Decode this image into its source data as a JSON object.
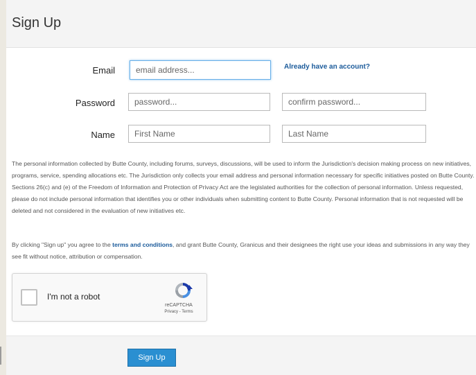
{
  "header": {
    "title": "Sign Up"
  },
  "form": {
    "email_label": "Email",
    "email_placeholder": "email address...",
    "account_link": "Already have an account?",
    "password_label": "Password",
    "password_placeholder": "password...",
    "confirm_placeholder": "confirm password...",
    "name_label": "Name",
    "first_placeholder": "First Name",
    "last_placeholder": "Last Name"
  },
  "privacy_text": "The personal information collected by Butte County, including forums, surveys, discussions, will be used to inform the Jurisdiction's decision making process on new initiatives, programs, service, spending allocations etc. The Jurisdiction only collects your email address and personal information necessary for specific initiatives posted on Butte County. Sections 26(c) and (e) of the Freedom of Information and Protection of Privacy Act are the legislated authorities for the collection of personal information. Unless requested, please do not include personal information that identifies you or other individuals when submitting content to Butte County. Personal information that is not requested will be deleted and not considered in the evaluation of new initiatives etc.",
  "terms": {
    "before": "By clicking \"Sign up\" you agree to the ",
    "link": "terms and conditions",
    "after": ", and grant Butte County, Granicus and their designees the right use your ideas and submissions in any way they see fit without notice, attribution or compensation."
  },
  "captcha": {
    "label": "I'm not a robot",
    "brand": "reCAPTCHA",
    "privacy_terms": "Privacy - Terms",
    "icon": "recaptcha-logo-icon",
    "checkbox_icon": "checkbox-icon"
  },
  "footer": {
    "submit_label": "Sign Up"
  },
  "colors": {
    "accent": "#2a8fd1",
    "link": "#1a5a9a",
    "page_bg": "#ece9e1"
  }
}
